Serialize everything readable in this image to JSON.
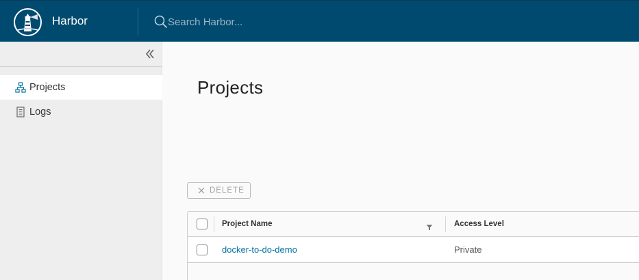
{
  "header": {
    "app_title": "Harbor",
    "search_placeholder": "Search Harbor...",
    "colors": {
      "background": "#004a70",
      "text": "#ffffff"
    }
  },
  "sidebar": {
    "collapse_icon": "double-chevron-left-icon",
    "items": [
      {
        "label": "Projects",
        "icon": "projects-icon",
        "active": true
      },
      {
        "label": "Logs",
        "icon": "logs-icon",
        "active": false
      }
    ]
  },
  "main": {
    "page_title": "Projects",
    "toolbar": {
      "delete_label": "DELETE",
      "delete_icon": "close-icon",
      "delete_enabled": false
    },
    "table": {
      "columns": [
        {
          "label": ""
        },
        {
          "label": "Project Name",
          "filterable": true
        },
        {
          "label": "Access Level"
        }
      ],
      "rows": [
        {
          "checked": false,
          "project_name": "docker-to-do-demo",
          "access_level": "Private"
        }
      ]
    },
    "colors": {
      "link": "#0072a3"
    }
  }
}
